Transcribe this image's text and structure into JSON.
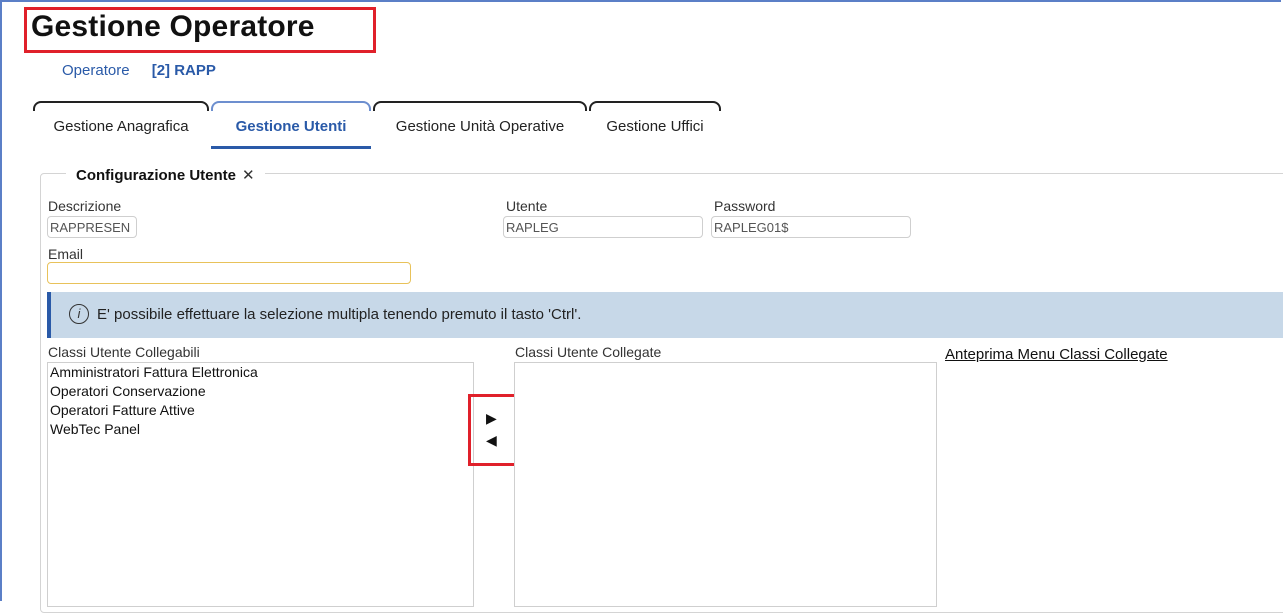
{
  "page": {
    "title": "Gestione Operatore"
  },
  "breadcrumb": {
    "link": "Operatore",
    "current": "[2] RAPP"
  },
  "tabs": [
    {
      "label": "Gestione Anagrafica",
      "active": false
    },
    {
      "label": "Gestione Utenti",
      "active": true
    },
    {
      "label": "Gestione Unità Operative",
      "active": false
    },
    {
      "label": "Gestione Uffici",
      "active": false
    }
  ],
  "config": {
    "legend": "Configurazione Utente",
    "close_glyph": "✕",
    "descrizione_label": "Descrizione",
    "descrizione_value": "RAPPRESEN",
    "utente_label": "Utente",
    "utente_value": "RAPLEG",
    "password_label": "Password",
    "password_value": "RAPLEG01$",
    "email_label": "Email",
    "email_value": ""
  },
  "info": {
    "icon": "info-icon",
    "text": "E' possibile effettuare la selezione multipla tenendo premuto il tasto 'Ctrl'."
  },
  "lists": {
    "available_label": "Classi Utente Collegabili",
    "available_items": [
      "Amministratori Fattura Elettronica",
      "Operatori Conservazione",
      "Operatori Fatture Attive",
      "WebTec Panel"
    ],
    "linked_label": "Classi Utente Collegate",
    "linked_items": []
  },
  "move_buttons": {
    "right": "▶",
    "left": "◀"
  },
  "preview": {
    "label": "Anteprima Menu Classi Collegate"
  },
  "colors": {
    "accent": "#2a5aa8",
    "highlight_box": "#e0202a",
    "info_bg": "#c7d8e8",
    "email_focus": "#e8c25a"
  }
}
